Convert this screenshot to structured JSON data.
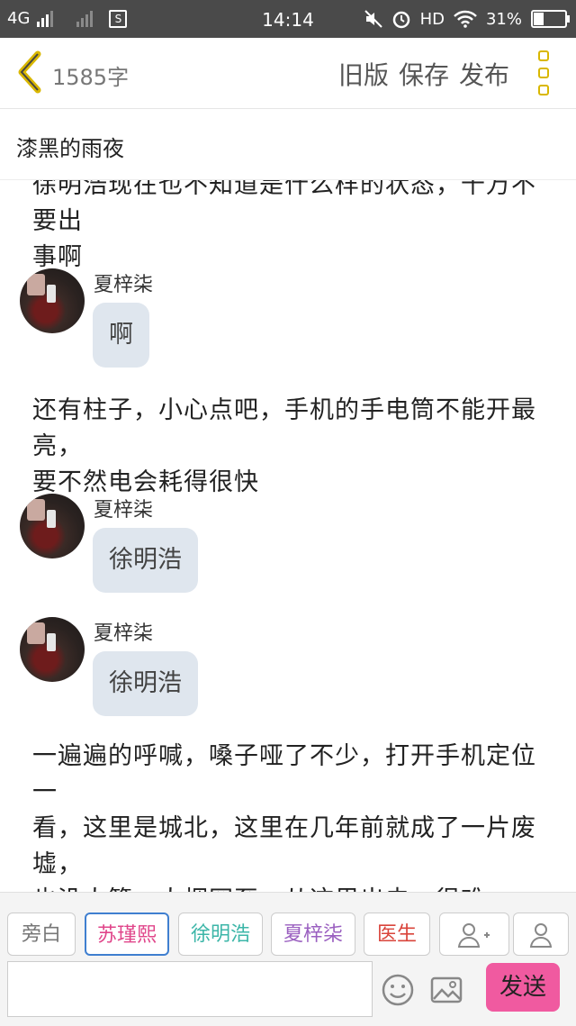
{
  "status": {
    "network": "4G",
    "time": "14:14",
    "hd": "HD",
    "battery": "31%",
    "sim_icon_letter": "S"
  },
  "header": {
    "word_count": "1585字",
    "old_version": "旧版",
    "save": "保存",
    "publish": "发布"
  },
  "story": {
    "title": "漆黑的雨夜"
  },
  "content": {
    "top_partial_line1": "徐明浩现在也不知道是什么样的状态，千万不要出",
    "top_partial_line2": "事啊",
    "messages": [
      {
        "sender": "夏梓柒",
        "text": "啊"
      },
      {
        "sender": "夏梓柒",
        "text": "徐明浩"
      },
      {
        "sender": "夏梓柒",
        "text": "徐明浩"
      }
    ],
    "narration_1_line1": "还有柱子，小心点吧，手机的手电筒不能开最亮，",
    "narration_1_line2": "要不然电会耗得很快",
    "narration_2_line1": "一遍遍的呼喊，嗓子哑了不少，打开手机定位一",
    "narration_2_line2": "看，这里是城北，这里在几年前就成了一片废墟，",
    "narration_2_line3": "也没人管，人烟罕至，从这里出去，很难"
  },
  "characters": [
    {
      "label": "旁白",
      "color": "#777777"
    },
    {
      "label": "苏瑾熙",
      "color": "#e0458a"
    },
    {
      "label": "徐明浩",
      "color": "#3cb6a8"
    },
    {
      "label": "夏梓柒",
      "color": "#9a5fc0"
    },
    {
      "label": "医生",
      "color": "#d9443b"
    }
  ],
  "composer": {
    "send_label": "发送",
    "icons": [
      "add-character-icon",
      "character-profile-icon",
      "emoji-icon",
      "image-icon"
    ]
  }
}
